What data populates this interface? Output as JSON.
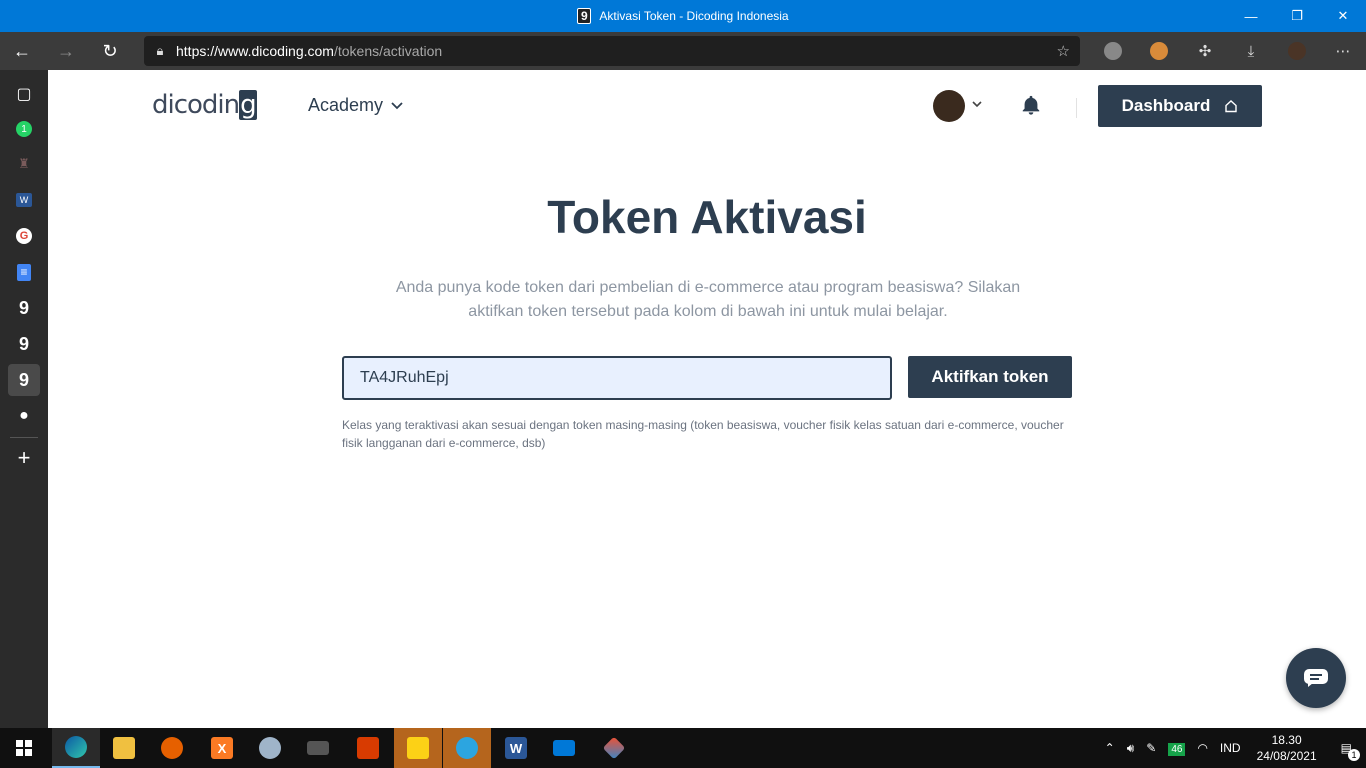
{
  "window": {
    "title": "Aktivasi Token - Dicoding Indonesia",
    "favicon": "9"
  },
  "browser": {
    "url_host": "https://www.dicoding.com",
    "url_path": "/tokens/activation"
  },
  "sidebar": {
    "items": [
      {
        "icon": "tabs-icon",
        "glyph": "▢"
      },
      {
        "icon": "whatsapp-icon",
        "glyph": "1"
      },
      {
        "icon": "castle-icon",
        "glyph": "♜"
      },
      {
        "icon": "word-icon",
        "glyph": "W"
      },
      {
        "icon": "google-icon",
        "glyph": "G"
      },
      {
        "icon": "docs-icon",
        "glyph": "≡"
      },
      {
        "icon": "dicoding-icon",
        "glyph": "9"
      },
      {
        "icon": "dicoding-icon",
        "glyph": "9"
      },
      {
        "icon": "dicoding-icon",
        "glyph": "9"
      },
      {
        "icon": "github-icon",
        "glyph": "●"
      }
    ],
    "add_glyph": "+"
  },
  "header": {
    "logo_text": "dicodin",
    "logo_last": "g",
    "menu_label": "Academy",
    "dashboard_label": "Dashboard"
  },
  "main": {
    "title": "Token Aktivasi",
    "subtitle": "Anda punya kode token dari pembelian di e-commerce atau program beasiswa? Silakan aktifkan token tersebut pada kolom di bawah ini untuk mulai belajar.",
    "token_value": "TA4JRuhEpj",
    "button_label": "Aktifkan token",
    "note": "Kelas yang teraktivasi akan sesuai dengan token masing-masing (token beasiswa, voucher fisik kelas satuan dari e-commerce, voucher fisik langganan dari e-commerce, dsb)"
  },
  "taskbar": {
    "tray_badge": "46",
    "language": "IND",
    "time": "18.30",
    "date": "24/08/2021",
    "notifications": "1"
  },
  "colors": {
    "primary": "#2d3e50",
    "titlebar": "#0078d7",
    "input_bg": "#e8f0fe"
  }
}
